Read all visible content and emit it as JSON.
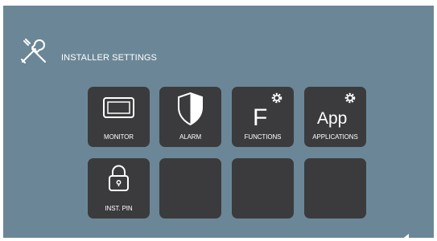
{
  "header": {
    "title": "INSTALLER SETTINGS",
    "icon": "tools-icon"
  },
  "tiles": [
    {
      "label": "MONITOR",
      "icon": "monitor-icon"
    },
    {
      "label": "ALARM",
      "icon": "shield-icon"
    },
    {
      "label": "FUNCTIONS",
      "icon": "functions-gear-icon",
      "glyph": "F"
    },
    {
      "label": "APPLICATIONS",
      "icon": "app-gear-icon",
      "glyph": "App"
    },
    {
      "label": "INST. PIN",
      "icon": "lock-icon"
    },
    {
      "label": "",
      "icon": ""
    },
    {
      "label": "",
      "icon": ""
    },
    {
      "label": "",
      "icon": ""
    }
  ],
  "colors": {
    "background": "#6b8797",
    "tile": "#3b3b3d",
    "foreground": "#ffffff"
  }
}
